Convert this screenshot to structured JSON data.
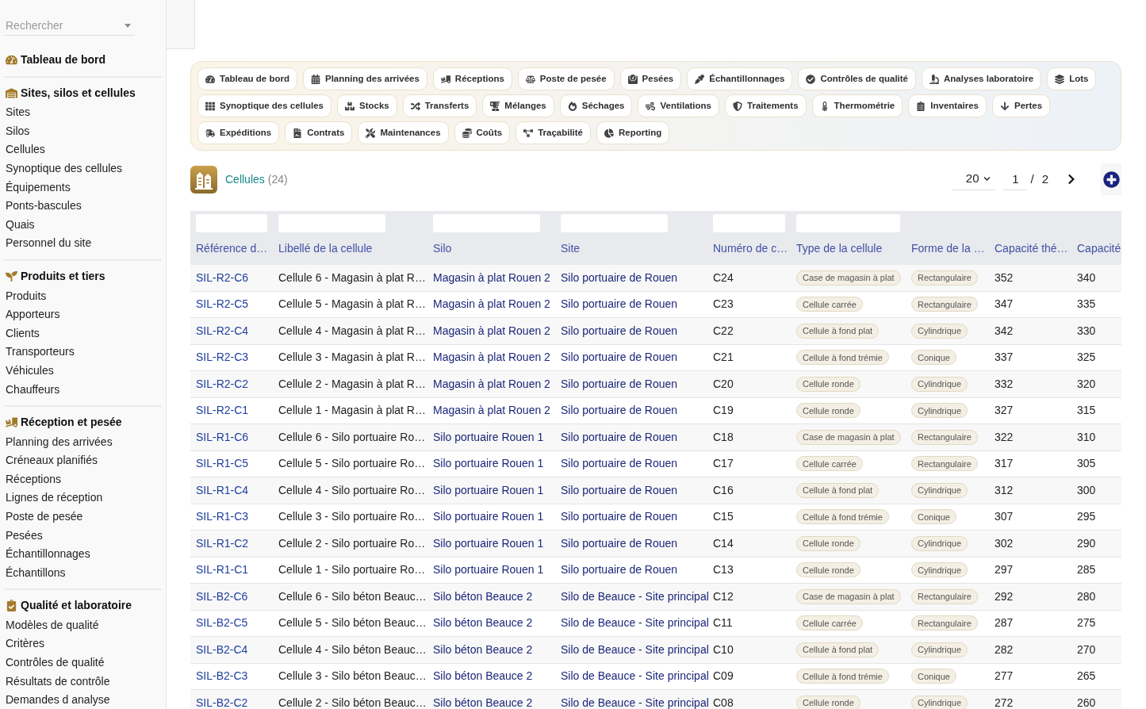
{
  "sidebar": {
    "search": {
      "placeholder": "Rechercher"
    },
    "groups": [
      {
        "heading": "Tableau de bord"
      },
      {
        "heading": "Sites, silos et cellules",
        "items": [
          "Sites",
          "Silos",
          "Cellules",
          "Synoptique des cellules",
          "Équipements",
          "Ponts-bascules",
          "Quais",
          "Personnel du site"
        ]
      },
      {
        "heading": "Produits et tiers",
        "items": [
          "Produits",
          "Apporteurs",
          "Clients",
          "Transporteurs",
          "Véhicules",
          "Chauffeurs"
        ]
      },
      {
        "heading": "Réception et pesée",
        "items": [
          "Planning des arrivées",
          "Créneaux planifiés",
          "Réceptions",
          "Lignes de réception",
          "Poste de pesée",
          "Pesées",
          "Échantillonnages",
          "Échantillons"
        ]
      },
      {
        "heading": "Qualité et laboratoire",
        "items": [
          "Modèles de qualité",
          "Critères",
          "Contrôles de qualité",
          "Résultats de contrôle",
          "Demandes d analyse"
        ]
      }
    ]
  },
  "nav": {
    "buttons": [
      "Tableau de bord",
      "Planning des arrivées",
      "Réceptions",
      "Poste de pesée",
      "Pesées",
      "Échantillonnages",
      "Contrôles de qualité",
      "Analyses laboratoire",
      "Lots",
      "Synoptique des cellules",
      "Stocks",
      "Transferts",
      "Mélanges",
      "Séchages",
      "Ventilations",
      "Traitements",
      "Thermométrie",
      "Inventaires",
      "Pertes",
      "Expéditions",
      "Contrats",
      "Maintenances",
      "Coûts",
      "Traçabilité",
      "Reporting"
    ]
  },
  "list": {
    "title": "Cellules",
    "count": "(24)",
    "pagination": {
      "page_size": "20",
      "page": "1",
      "separator": "/",
      "total_pages": "2"
    }
  },
  "table": {
    "columns": [
      {
        "label": "Référence d…",
        "kind": "id",
        "filter": true
      },
      {
        "label": "Libellé de la cellule",
        "kind": "text",
        "filter": true
      },
      {
        "label": "Silo",
        "kind": "link",
        "filter": true
      },
      {
        "label": "Site",
        "kind": "link",
        "filter": true
      },
      {
        "label": "Numéro de c…",
        "kind": "text",
        "filter": true
      },
      {
        "label": "Type de la cellule",
        "kind": "badge",
        "filter": true
      },
      {
        "label": "Forme de la …",
        "kind": "badge",
        "filter": false
      },
      {
        "label": "Capacité thé…",
        "kind": "text",
        "filter": false
      },
      {
        "label": "Capacité",
        "kind": "text",
        "filter": false
      }
    ],
    "rows": [
      [
        "SIL-R2-C6",
        "Cellule 6 - Magasin à plat R…",
        "Magasin à plat Rouen 2",
        "Silo portuaire de Rouen",
        "C24",
        "Case de magasin à plat",
        "Rectangulaire",
        "352",
        "340"
      ],
      [
        "SIL-R2-C5",
        "Cellule 5 - Magasin à plat R…",
        "Magasin à plat Rouen 2",
        "Silo portuaire de Rouen",
        "C23",
        "Cellule carrée",
        "Rectangulaire",
        "347",
        "335"
      ],
      [
        "SIL-R2-C4",
        "Cellule 4 - Magasin à plat R…",
        "Magasin à plat Rouen 2",
        "Silo portuaire de Rouen",
        "C22",
        "Cellule à fond plat",
        "Cylindrique",
        "342",
        "330"
      ],
      [
        "SIL-R2-C3",
        "Cellule 3 - Magasin à plat R…",
        "Magasin à plat Rouen 2",
        "Silo portuaire de Rouen",
        "C21",
        "Cellule à fond trémie",
        "Conique",
        "337",
        "325"
      ],
      [
        "SIL-R2-C2",
        "Cellule 2 - Magasin à plat R…",
        "Magasin à plat Rouen 2",
        "Silo portuaire de Rouen",
        "C20",
        "Cellule ronde",
        "Cylindrique",
        "332",
        "320"
      ],
      [
        "SIL-R2-C1",
        "Cellule 1 - Magasin à plat R…",
        "Magasin à plat Rouen 2",
        "Silo portuaire de Rouen",
        "C19",
        "Cellule ronde",
        "Cylindrique",
        "327",
        "315"
      ],
      [
        "SIL-R1-C6",
        "Cellule 6 - Silo portuaire Ro…",
        "Silo portuaire Rouen 1",
        "Silo portuaire de Rouen",
        "C18",
        "Case de magasin à plat",
        "Rectangulaire",
        "322",
        "310"
      ],
      [
        "SIL-R1-C5",
        "Cellule 5 - Silo portuaire Ro…",
        "Silo portuaire Rouen 1",
        "Silo portuaire de Rouen",
        "C17",
        "Cellule carrée",
        "Rectangulaire",
        "317",
        "305"
      ],
      [
        "SIL-R1-C4",
        "Cellule 4 - Silo portuaire Ro…",
        "Silo portuaire Rouen 1",
        "Silo portuaire de Rouen",
        "C16",
        "Cellule à fond plat",
        "Cylindrique",
        "312",
        "300"
      ],
      [
        "SIL-R1-C3",
        "Cellule 3 - Silo portuaire Ro…",
        "Silo portuaire Rouen 1",
        "Silo portuaire de Rouen",
        "C15",
        "Cellule à fond trémie",
        "Conique",
        "307",
        "295"
      ],
      [
        "SIL-R1-C2",
        "Cellule 2 - Silo portuaire Ro…",
        "Silo portuaire Rouen 1",
        "Silo portuaire de Rouen",
        "C14",
        "Cellule ronde",
        "Cylindrique",
        "302",
        "290"
      ],
      [
        "SIL-R1-C1",
        "Cellule 1 - Silo portuaire Ro…",
        "Silo portuaire Rouen 1",
        "Silo portuaire de Rouen",
        "C13",
        "Cellule ronde",
        "Cylindrique",
        "297",
        "285"
      ],
      [
        "SIL-B2-C6",
        "Cellule 6 - Silo béton Beauc…",
        "Silo béton Beauce 2",
        "Silo de Beauce - Site principal",
        "C12",
        "Case de magasin à plat",
        "Rectangulaire",
        "292",
        "280"
      ],
      [
        "SIL-B2-C5",
        "Cellule 5 - Silo béton Beauc…",
        "Silo béton Beauce 2",
        "Silo de Beauce - Site principal",
        "C11",
        "Cellule carrée",
        "Rectangulaire",
        "287",
        "275"
      ],
      [
        "SIL-B2-C4",
        "Cellule 4 - Silo béton Beauc…",
        "Silo béton Beauce 2",
        "Silo de Beauce - Site principal",
        "C10",
        "Cellule à fond plat",
        "Cylindrique",
        "282",
        "270"
      ],
      [
        "SIL-B2-C3",
        "Cellule 3 - Silo béton Beauc…",
        "Silo béton Beauce 2",
        "Silo de Beauce - Site principal",
        "C09",
        "Cellule à fond trémie",
        "Conique",
        "277",
        "265"
      ],
      [
        "SIL-B2-C2",
        "Cellule 2 - Silo béton Beauc…",
        "Silo béton Beauce 2",
        "Silo de Beauce - Site principal",
        "C08",
        "Cellule ronde",
        "Cylindrique",
        "272",
        "260"
      ]
    ]
  }
}
